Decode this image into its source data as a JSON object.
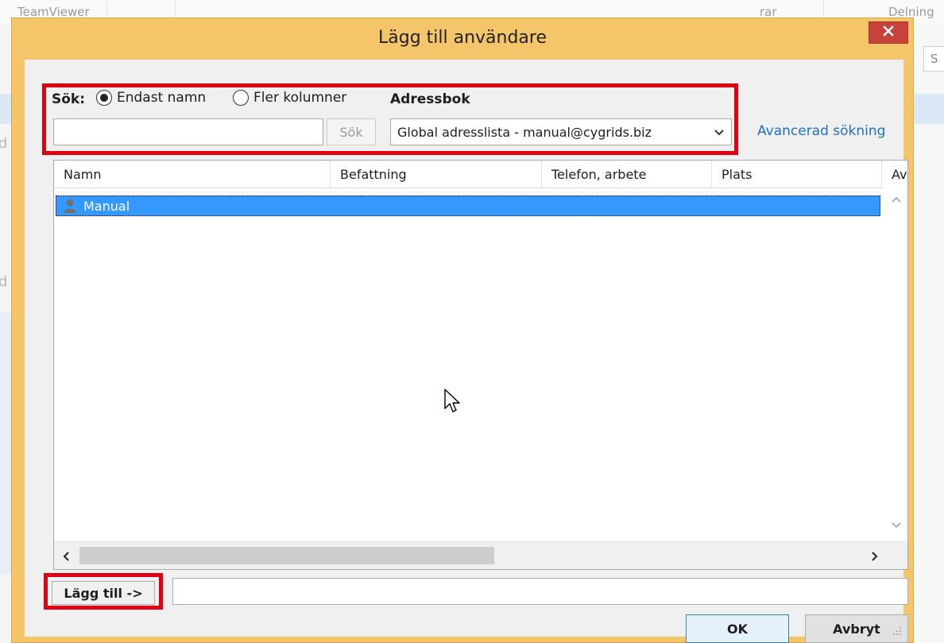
{
  "background_app": {
    "tab_left": "TeamViewer",
    "tab_mid": "rar",
    "tab_right": "Delning"
  },
  "dialog": {
    "title": "Lägg till användare",
    "close_icon": "close-icon"
  },
  "search": {
    "label": "Sök:",
    "radio_name_only": "Endast namn",
    "radio_more_columns": "Fler kolumner",
    "selected_radio": "Endast namn",
    "input_value": "",
    "button_label": "Sök",
    "addressbook_label": "Adressbok",
    "addressbook_value": "Global adresslista - manual@cygrids.biz",
    "advanced_link": "Avancerad sökning"
  },
  "list": {
    "columns": [
      "Namn",
      "Befattning",
      "Telefon, arbete",
      "Plats",
      "Av"
    ],
    "rows": [
      {
        "name": "Manual",
        "selected": true,
        "icon": "user-icon"
      }
    ]
  },
  "bottom": {
    "add_button": "Lägg till ->",
    "add_input_value": "",
    "ok_button": "OK",
    "cancel_button": "Avbryt"
  },
  "colors": {
    "dialog_frame": "#f5c669",
    "highlight": "#e1000f",
    "selection": "#3399ff",
    "link": "#1f6fc8",
    "close_button": "#c6423a"
  }
}
